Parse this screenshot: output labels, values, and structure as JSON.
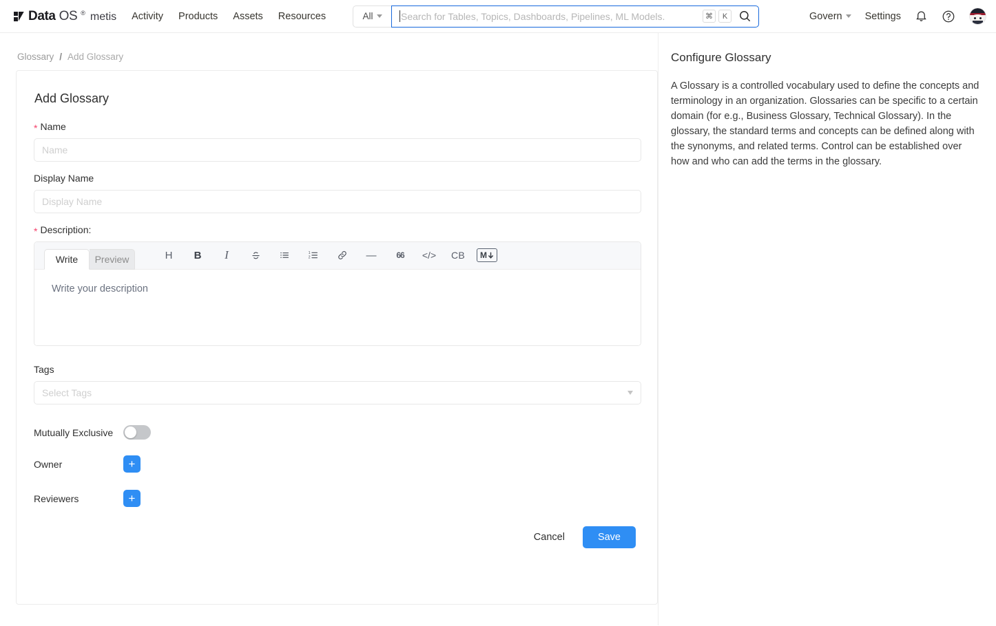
{
  "topbar": {
    "brand": {
      "data": "Data",
      "os": "OS",
      "reg": "®",
      "product": "metis",
      "mark": "dataos-logo-mark"
    },
    "nav": [
      {
        "label": "Activity"
      },
      {
        "label": "Products"
      },
      {
        "label": "Assets"
      },
      {
        "label": "Resources"
      }
    ],
    "search": {
      "scope": "All",
      "placeholder": "Search for Tables, Topics, Dashboards, Pipelines, ML Models.",
      "value": "",
      "shortcut_meta": "⌘",
      "shortcut_key": "K",
      "search_icon": "search-icon",
      "focus_color": "#1668dc"
    },
    "right": {
      "govern": "Govern",
      "settings": "Settings",
      "bell_icon": "notification-bell-icon",
      "help_icon": "help-circle-icon",
      "avatar": "user-avatar"
    }
  },
  "breadcrumb": {
    "parent": "Glossary",
    "separator": "/",
    "current": "Add Glossary"
  },
  "form": {
    "title": "Add Glossary",
    "name": {
      "label": "Name",
      "required": "*",
      "placeholder": "Name",
      "value": ""
    },
    "display_name": {
      "label": "Display Name",
      "placeholder": "Display Name",
      "value": ""
    },
    "description": {
      "label": "Description:",
      "required": "*",
      "tabs": [
        {
          "label": "Write",
          "active": true
        },
        {
          "label": "Preview",
          "active": false
        }
      ],
      "tools": [
        {
          "name": "heading-icon",
          "glyph": "H"
        },
        {
          "name": "bold-icon",
          "glyph": "B"
        },
        {
          "name": "italic-icon",
          "glyph": "I"
        },
        {
          "name": "strikethrough-icon",
          "glyph": "S"
        },
        {
          "name": "bullet-list-icon",
          "glyph": ""
        },
        {
          "name": "numbered-list-icon",
          "glyph": ""
        },
        {
          "name": "link-icon",
          "glyph": ""
        },
        {
          "name": "horizontal-rule-icon",
          "glyph": "—"
        },
        {
          "name": "blockquote-icon",
          "glyph": "66"
        },
        {
          "name": "inline-code-icon",
          "glyph": "</>"
        },
        {
          "name": "code-block-icon",
          "glyph": "CB"
        },
        {
          "name": "markdown-icon",
          "glyph": "M"
        }
      ],
      "placeholder": "Write your description",
      "value": ""
    },
    "tags": {
      "label": "Tags",
      "placeholder": "Select Tags",
      "value": ""
    },
    "mutually_exclusive": {
      "label": "Mutually Exclusive",
      "enabled": false
    },
    "owner": {
      "label": "Owner",
      "add_label": "+"
    },
    "reviewers": {
      "label": "Reviewers",
      "add_label": "+"
    },
    "cancel_label": "Cancel",
    "save_label": "Save",
    "accent_color": "#2f8ef4",
    "required_color": "#f5426c"
  },
  "panel": {
    "title": "Configure Glossary",
    "body": "A Glossary is a controlled vocabulary used to define the concepts and terminology in an organization. Glossaries can be specific to a certain domain (for e.g., Business Glossary, Technical Glossary). In the glossary, the standard terms and concepts can be defined along with the synonyms, and related terms. Control can be established over how and who can add the terms in the glossary."
  }
}
